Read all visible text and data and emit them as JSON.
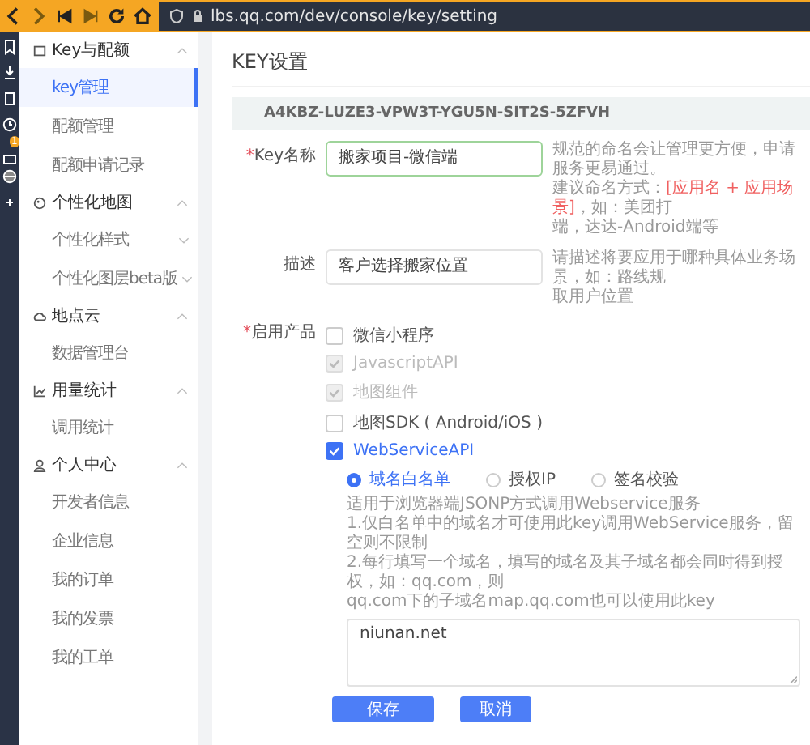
{
  "browser": {
    "url": "lbs.qq.com/dev/console/key/setting",
    "badge": "1"
  },
  "sidebar": {
    "groups": [
      {
        "label": "Key与配额",
        "expanded": true,
        "items": [
          {
            "label": "key管理",
            "selected": true,
            "has_children": false
          },
          {
            "label": "配额管理",
            "selected": false,
            "has_children": false
          },
          {
            "label": "配额申请记录",
            "selected": false,
            "has_children": false
          }
        ]
      },
      {
        "label": "个性化地图",
        "expanded": true,
        "items": [
          {
            "label": "个性化样式",
            "selected": false,
            "has_children": true
          },
          {
            "label": "个性化图层beta版",
            "selected": false,
            "has_children": true
          }
        ]
      },
      {
        "label": "地点云",
        "expanded": true,
        "items": [
          {
            "label": "数据管理台",
            "selected": false,
            "has_children": false
          }
        ]
      },
      {
        "label": "用量统计",
        "expanded": true,
        "items": [
          {
            "label": "调用统计",
            "selected": false,
            "has_children": false
          }
        ]
      },
      {
        "label": "个人中心",
        "expanded": true,
        "items": [
          {
            "label": "开发者信息",
            "selected": false,
            "has_children": false
          },
          {
            "label": "企业信息",
            "selected": false,
            "has_children": false
          },
          {
            "label": "我的订单",
            "selected": false,
            "has_children": false
          },
          {
            "label": "我的发票",
            "selected": false,
            "has_children": false
          },
          {
            "label": "我的工单",
            "selected": false,
            "has_children": false
          }
        ]
      }
    ]
  },
  "page_title": "KEY设置",
  "key_value": "A4KBZ-LUZE3-VPW3T-YGU5N-SIT2S-5ZFVH",
  "form": {
    "name": {
      "label": "Key名称",
      "required_mark": "*",
      "value": "搬家项目-微信端",
      "hint": [
        [
          {
            "text": "规范的命名会让管理更方便，申请服务更易通过。",
            "highlight": false
          }
        ],
        [
          {
            "text": "建议命名方式：",
            "highlight": false
          },
          {
            "text": "[应用名 + 应用场景]",
            "highlight": true
          },
          {
            "text": "，如：美团打",
            "highlight": false
          }
        ],
        [
          {
            "text": "端，达达-Android端等",
            "highlight": false
          }
        ]
      ]
    },
    "description": {
      "label": "描述",
      "value": "客户选择搬家位置",
      "hint": [
        [
          {
            "text": "请描述将要应用于哪种具体业务场景，如：路线规",
            "highlight": false
          }
        ],
        [
          {
            "text": "取用户位置",
            "highlight": false
          }
        ]
      ]
    },
    "products": {
      "label": "启用产品",
      "required_mark": "*",
      "items": [
        {
          "label": "微信小程序",
          "checked": false,
          "disabled": false
        },
        {
          "label": "JavascriptAPI",
          "checked": true,
          "disabled": true
        },
        {
          "label": "地图组件",
          "checked": true,
          "disabled": true
        },
        {
          "label": "地图SDK ( Android/iOS )",
          "checked": false,
          "disabled": false
        },
        {
          "label": "WebServiceAPI",
          "checked": true,
          "disabled": false
        }
      ]
    },
    "auth_options": [
      {
        "label": "域名白名单",
        "selected": true
      },
      {
        "label": "授权IP",
        "selected": false
      },
      {
        "label": "签名校验",
        "selected": false
      }
    ],
    "notes": [
      "适用于浏览器端JSONP方式调用Webservice服务",
      "1.仅白名单中的域名才可使用此key调用WebService服务，留空则不限制",
      "2.每行填写一个域名，填写的域名及其子域名都会同时得到授权，如：qq.com，则",
      "qq.com下的子域名map.qq.com也可以使用此key"
    ],
    "whitelist": "niunan.net"
  },
  "buttons": [
    {
      "label": "保存",
      "kind": "primary"
    },
    {
      "label": "取消",
      "kind": "secondary"
    }
  ]
}
